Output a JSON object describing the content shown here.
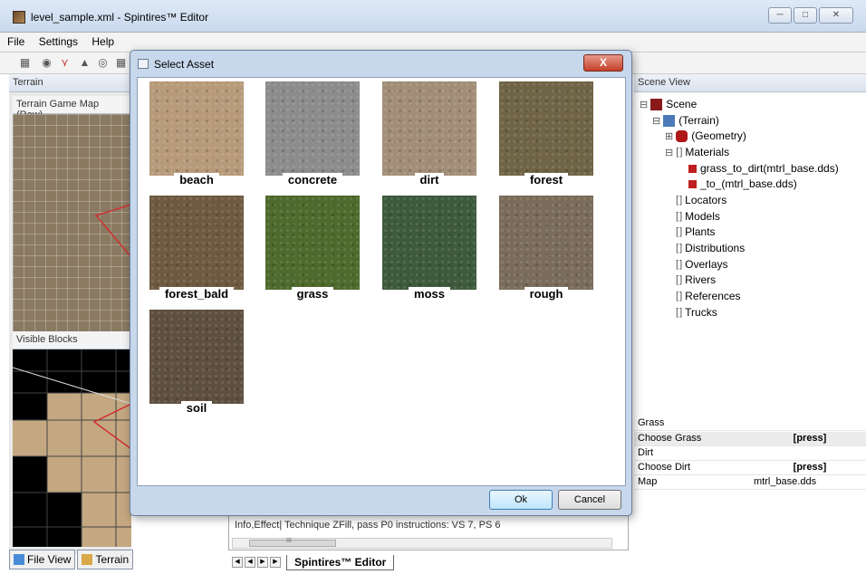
{
  "window": {
    "title": "level_sample.xml - Spintires™ Editor"
  },
  "menu": [
    "File",
    "Settings",
    "Help"
  ],
  "left_panel": {
    "header": "Terrain",
    "map_label": "Terrain Game Map (Raw)",
    "blocks_label": "Visible Blocks",
    "tabs": [
      "File View",
      "Terrain"
    ]
  },
  "dialog": {
    "title": "Select Asset",
    "close_label": "X",
    "assets": [
      {
        "label": "beach",
        "color": "#b79a7a"
      },
      {
        "label": "concrete",
        "color": "#8c8c8c"
      },
      {
        "label": "dirt",
        "color": "#a28e78"
      },
      {
        "label": "forest",
        "color": "#6f6446"
      },
      {
        "label": "forest_bald",
        "color": "#6e5a40"
      },
      {
        "label": "grass",
        "color": "#4e6a2c"
      },
      {
        "label": "moss",
        "color": "#3e5a3c"
      },
      {
        "label": "rough",
        "color": "#7a6c5a"
      },
      {
        "label": "soil",
        "color": "#5e5040"
      }
    ],
    "ok_label": "Ok",
    "cancel_label": "Cancel"
  },
  "scene": {
    "header": "Scene View",
    "root": "Scene",
    "terrain": "(Terrain)",
    "geometry": "(Geometry)",
    "materials": "Materials",
    "material_items": [
      "grass_to_dirt(mtrl_base.dds)",
      "_to_(mtrl_base.dds)"
    ],
    "categories": [
      "Locators",
      "Models",
      "Plants",
      "Distributions",
      "Overlays",
      "Rivers",
      "References",
      "Trucks"
    ]
  },
  "properties": [
    {
      "name": "Grass",
      "value": ""
    },
    {
      "name": "Choose Grass",
      "value": "[press]"
    },
    {
      "name": "Dirt",
      "value": ""
    },
    {
      "name": "Choose Dirt",
      "value": "[press]"
    },
    {
      "name": "Map",
      "value": "mtrl_base.dds"
    }
  ],
  "output": {
    "text": "Info,Effect| Technique ZFill, pass P0 instructions: VS 7, PS 6",
    "scroll_mark": "III"
  },
  "doc_tab": "Spintires™ Editor"
}
